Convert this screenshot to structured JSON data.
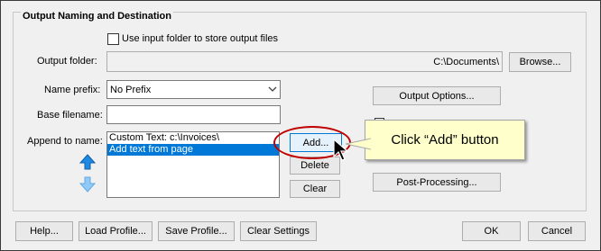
{
  "group": {
    "title": "Output Naming and Destination"
  },
  "use_input_folder": {
    "label": "Use input folder to store output files",
    "checked": false
  },
  "output_folder": {
    "label": "Output folder:",
    "value": "C:\\Documents\\",
    "browse_label": "Browse..."
  },
  "name_prefix": {
    "label": "Name prefix:",
    "value": "No Prefix"
  },
  "base_filename": {
    "label": "Base filename:",
    "value": ""
  },
  "append_to_name": {
    "label": "Append to name:",
    "items": [
      "Custom Text: c:\\Invoices\\",
      "Add text from page"
    ],
    "selected_index": 1
  },
  "list_buttons": {
    "add": "Add...",
    "delete": "Delete",
    "clear": "Clear"
  },
  "right_buttons": {
    "output_options": "Output Options...",
    "post_processing": "Post-Processing..."
  },
  "footer": {
    "help": "Help...",
    "load_profile": "Load Profile...",
    "save_profile": "Save Profile...",
    "clear_settings": "Clear Settings",
    "ok": "OK",
    "cancel": "Cancel"
  },
  "callout": {
    "text": "Click “Add” button"
  },
  "colors": {
    "selection": "#0078d7",
    "arrow_up": "#1e88e5",
    "arrow_down": "#90caf9",
    "highlight_ring": "#c00000",
    "callout_bg": "#ffffcc"
  },
  "icons": {
    "move_up": "arrow-up-icon",
    "move_down": "arrow-down-icon",
    "dropdown": "chevron-down-icon",
    "cursor": "mouse-pointer-icon"
  }
}
